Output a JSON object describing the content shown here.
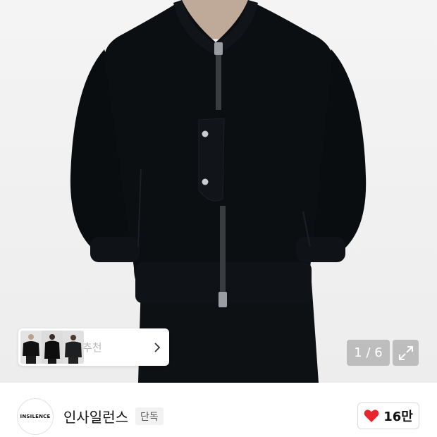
{
  "product": {
    "image_alt": "black wool bomber jacket",
    "pager_text": "1 / 6"
  },
  "recommend": {
    "label": "추천"
  },
  "shop": {
    "logo_text": "INSILENCE",
    "name": "인사일런스",
    "badge": "단독",
    "likes": "16만"
  },
  "colors": {
    "heart": "#e8242c",
    "jacket": "#0b0f12",
    "hint_text": "#b9b9b9"
  },
  "icons": {
    "reco_chevron": "chevron-right-icon",
    "expand": "expand-icon",
    "like": "heart-icon"
  }
}
